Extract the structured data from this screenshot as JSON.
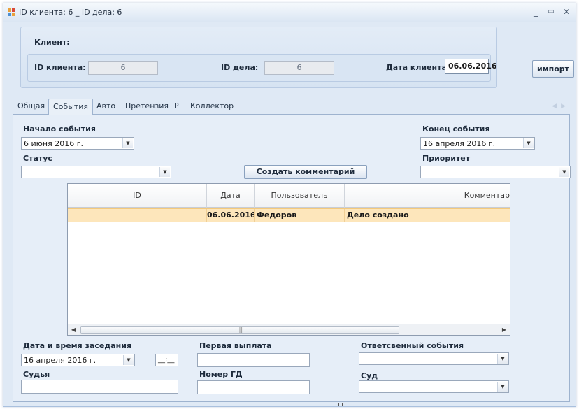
{
  "window": {
    "title": "ID клиента: 6 _ ID дела: 6",
    "minimize": "_",
    "maximize": "▭",
    "close": "✕"
  },
  "client": {
    "group_label": "Клиент:",
    "id_client_label": "ID клиента:",
    "id_client_value": "6",
    "id_case_label": "ID дела:",
    "id_case_value": "6",
    "date_label": "Дата клиента:",
    "date_value": "06.06.2016"
  },
  "import_button": "импорт",
  "tabs": [
    {
      "label": "Общая"
    },
    {
      "label": "События",
      "active": true
    },
    {
      "label": "Авто"
    },
    {
      "label": "Претензия"
    },
    {
      "label": "Р"
    },
    {
      "label": "Коллектор"
    }
  ],
  "events": {
    "start_label": "Начало события",
    "start_value": "6 июня 2016 г.",
    "end_label": "Конец события",
    "end_value": "16 апреля 2016 г.",
    "status_label": "Статус",
    "status_value": "",
    "priority_label": "Приоритет",
    "priority_value": "",
    "create_comment_button": "Создать комментарий"
  },
  "grid": {
    "columns": [
      "ID",
      "Дата",
      "Пользователь",
      "Комментар"
    ],
    "rows": [
      {
        "id": "",
        "date": "06.06.2016",
        "user": "Федоров",
        "comment": "Дело создано"
      }
    ],
    "scroll_marker": "|||"
  },
  "bottom": {
    "session_label": "Дата и время заседания",
    "session_date": "16 апреля 2016 г.",
    "session_time": "__:__",
    "judge_label": "Судья",
    "judge_value": "",
    "first_payment_label": "Первая выплата",
    "first_payment_value": "",
    "case_number_label": "Номер ГД",
    "case_number_value": "",
    "responsible_label": "Ответсвенный события",
    "responsible_value": "",
    "court_label": "Суд",
    "court_value": ""
  }
}
